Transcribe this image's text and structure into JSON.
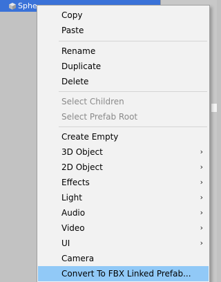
{
  "hierarchy": {
    "selected_item_label": "Sphe",
    "icon": "cube-icon"
  },
  "context_menu": {
    "items": {
      "copy": "Copy",
      "paste": "Paste",
      "rename": "Rename",
      "duplicate": "Duplicate",
      "delete": "Delete",
      "select_children": "Select Children",
      "select_prefab_root": "Select Prefab Root",
      "create_empty": "Create Empty",
      "object_3d": "3D Object",
      "object_2d": "2D Object",
      "effects": "Effects",
      "light": "Light",
      "audio": "Audio",
      "video": "Video",
      "ui": "UI",
      "camera": "Camera",
      "convert_fbx": "Convert To FBX Linked Prefab..."
    },
    "submenu_arrow": "›",
    "disabled_items": [
      "Select Children",
      "Select Prefab Root"
    ],
    "highlighted_item": "Convert To FBX Linked Prefab..."
  },
  "colors": {
    "selection_blue": "#3a72d8",
    "menu_background": "#f2f2f2",
    "highlight": "#91c9f7",
    "disabled_text": "#8a8a8a"
  }
}
